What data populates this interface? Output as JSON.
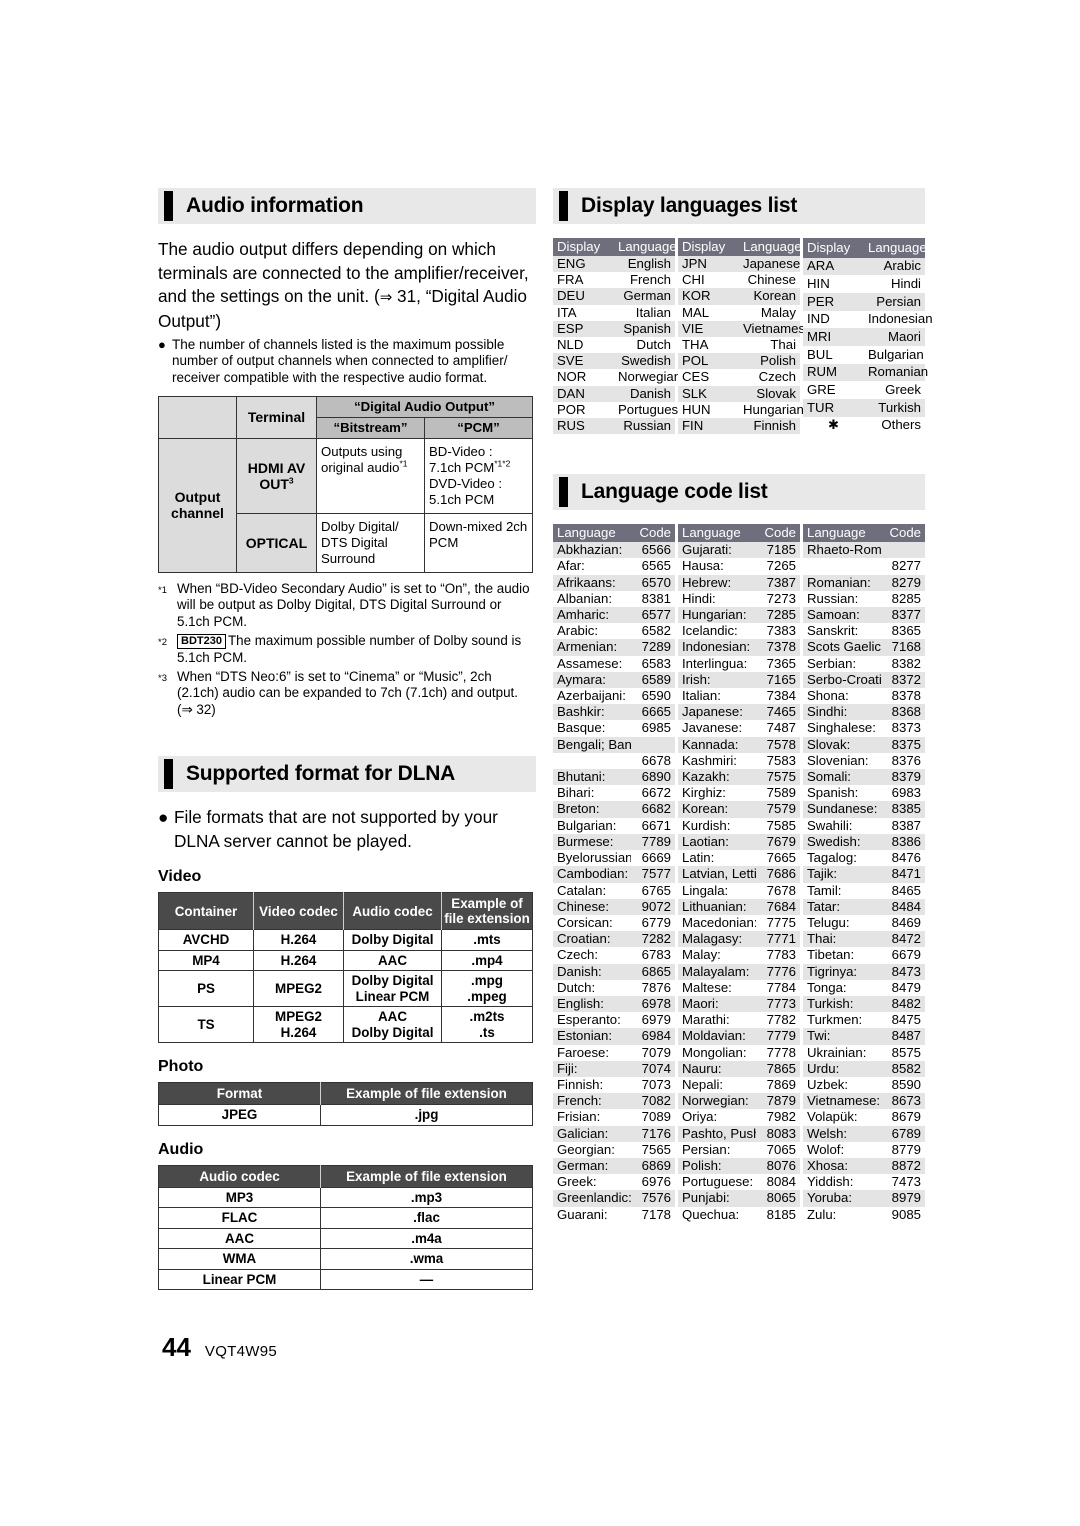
{
  "page": {
    "number": "44",
    "doc_code": "VQT4W95"
  },
  "audio_information": {
    "heading": "Audio information",
    "intro_line1": "The audio output differs depending on which",
    "intro_line2": "terminals are connected to the amplifier/receiver,",
    "intro_line3": "and the settings on the unit. (",
    "intro_arrow": "⇒",
    "intro_line3b": " 31, “Digital Audio",
    "intro_line4": "Output”)",
    "bullet": "The number of channels listed is the maximum possible number of output channels when connected to amplifier/ receiver compatible with the respective audio format.",
    "table": {
      "col_terminal": "Terminal",
      "col_group": "“Digital Audio Output”",
      "col_bitstream": "“Bitstream”",
      "col_pcm": "“PCM”",
      "row_label": "Output channel",
      "rows": [
        {
          "terminal": "HDMI AV OUT",
          "terminal_sup": "3",
          "bitstream": "Outputs using original audio",
          "bitstream_sup": "*1",
          "pcm_l1": "BD-Video :",
          "pcm_l2": "7.1ch PCM",
          "pcm_l2_sup": "*1*2",
          "pcm_l3": "DVD-Video :",
          "pcm_l4": "5.1ch PCM"
        },
        {
          "terminal": "OPTICAL",
          "terminal_sup": "",
          "bitstream": "Dolby Digital/ DTS Digital Surround",
          "bitstream_sup": "",
          "pcm_l1": "Down-mixed 2ch PCM",
          "pcm_l2": "",
          "pcm_l2_sup": "",
          "pcm_l3": "",
          "pcm_l4": ""
        }
      ]
    },
    "footnotes": [
      {
        "mark": "*1",
        "badge": "",
        "text": "When “BD-Video Secondary Audio” is set to “On”, the audio will be output as Dolby Digital, DTS Digital Surround or 5.1ch PCM."
      },
      {
        "mark": "*2",
        "badge": "BDT230",
        "text": "The maximum possible number of Dolby sound is 5.1ch PCM."
      },
      {
        "mark": "*3",
        "badge": "",
        "text": "When “DTS Neo:6” is set to “Cinema” or “Music”, 2ch (2.1ch) audio can be expanded to 7ch (7.1ch) and output. (⇒ 32)"
      }
    ]
  },
  "dlna": {
    "heading": "Supported format for DLNA",
    "bullet": "File formats that are not supported by your DLNA server cannot be played.",
    "video": {
      "subhead": "Video",
      "headers": [
        "Container",
        "Video codec",
        "Audio codec",
        "Example of file extension"
      ],
      "rows": [
        [
          "AVCHD",
          "H.264",
          "Dolby Digital",
          ".mts"
        ],
        [
          "MP4",
          "H.264",
          "AAC",
          ".mp4"
        ],
        [
          "PS",
          "MPEG2",
          "Dolby Digital\nLinear PCM",
          ".mpg\n.mpeg"
        ],
        [
          "TS",
          "MPEG2\nH.264",
          "AAC\nDolby Digital",
          ".m2ts\n.ts"
        ]
      ]
    },
    "photo": {
      "subhead": "Photo",
      "headers": [
        "Format",
        "Example of file extension"
      ],
      "rows": [
        [
          "JPEG",
          ".jpg"
        ]
      ]
    },
    "audio": {
      "subhead": "Audio",
      "headers": [
        "Audio codec",
        "Example of file extension"
      ],
      "rows": [
        [
          "MP3",
          ".mp3"
        ],
        [
          "FLAC",
          ".flac"
        ],
        [
          "AAC",
          ".m4a"
        ],
        [
          "WMA",
          ".wma"
        ],
        [
          "Linear PCM",
          "—"
        ]
      ]
    }
  },
  "display_languages": {
    "heading": "Display languages list",
    "col_display": "Display",
    "col_language": "Language",
    "columns": [
      [
        [
          "ENG",
          "English"
        ],
        [
          "FRA",
          "French"
        ],
        [
          "DEU",
          "German"
        ],
        [
          "ITA",
          "Italian"
        ],
        [
          "ESP",
          "Spanish"
        ],
        [
          "NLD",
          "Dutch"
        ],
        [
          "SVE",
          "Swedish"
        ],
        [
          "NOR",
          "Norwegian"
        ],
        [
          "DAN",
          "Danish"
        ],
        [
          "POR",
          "Portuguese"
        ],
        [
          "RUS",
          "Russian"
        ]
      ],
      [
        [
          "JPN",
          "Japanese"
        ],
        [
          "CHI",
          "Chinese"
        ],
        [
          "KOR",
          "Korean"
        ],
        [
          "MAL",
          "Malay"
        ],
        [
          "VIE",
          "Vietnamese"
        ],
        [
          "THA",
          "Thai"
        ],
        [
          "POL",
          "Polish"
        ],
        [
          "CES",
          "Czech"
        ],
        [
          "SLK",
          "Slovak"
        ],
        [
          "HUN",
          "Hungarian"
        ],
        [
          "FIN",
          "Finnish"
        ]
      ],
      [
        [
          "ARA",
          "Arabic"
        ],
        [
          "HIN",
          "Hindi"
        ],
        [
          "PER",
          "Persian"
        ],
        [
          "IND",
          "Indonesian"
        ],
        [
          "MRI",
          "Maori"
        ],
        [
          "BUL",
          "Bulgarian"
        ],
        [
          "RUM",
          "Romanian"
        ],
        [
          "GRE",
          "Greek"
        ],
        [
          "TUR",
          "Turkish"
        ],
        [
          "✱",
          "Others"
        ]
      ]
    ]
  },
  "language_codes": {
    "heading": "Language code list",
    "col_language": "Language",
    "col_code": "Code",
    "columns": [
      [
        [
          "Abkhazian:",
          "6566"
        ],
        [
          "Afar:",
          "6565"
        ],
        [
          "Afrikaans:",
          "6570"
        ],
        [
          "Albanian:",
          "8381"
        ],
        [
          "Amharic:",
          "6577"
        ],
        [
          "Arabic:",
          "6582"
        ],
        [
          "Armenian:",
          "7289"
        ],
        [
          "Assamese:",
          "6583"
        ],
        [
          "Aymara:",
          "6589"
        ],
        [
          "Azerbaijani:",
          "6590"
        ],
        [
          "Bashkir:",
          "6665"
        ],
        [
          "Basque:",
          "6985"
        ],
        [
          "Bengali; Bangla:",
          ""
        ],
        [
          "",
          "6678"
        ],
        [
          "Bhutani:",
          "6890"
        ],
        [
          "Bihari:",
          "6672"
        ],
        [
          "Breton:",
          "6682"
        ],
        [
          "Bulgarian:",
          "6671"
        ],
        [
          "Burmese:",
          "7789"
        ],
        [
          "Byelorussian:",
          "6669"
        ],
        [
          "Cambodian:",
          "7577"
        ],
        [
          "Catalan:",
          "6765"
        ],
        [
          "Chinese:",
          "9072"
        ],
        [
          "Corsican:",
          "6779"
        ],
        [
          "Croatian:",
          "7282"
        ],
        [
          "Czech:",
          "6783"
        ],
        [
          "Danish:",
          "6865"
        ],
        [
          "Dutch:",
          "7876"
        ],
        [
          "English:",
          "6978"
        ],
        [
          "Esperanto:",
          "6979"
        ],
        [
          "Estonian:",
          "6984"
        ],
        [
          "Faroese:",
          "7079"
        ],
        [
          "Fiji:",
          "7074"
        ],
        [
          "Finnish:",
          "7073"
        ],
        [
          "French:",
          "7082"
        ],
        [
          "Frisian:",
          "7089"
        ],
        [
          "Galician:",
          "7176"
        ],
        [
          "Georgian:",
          "7565"
        ],
        [
          "German:",
          "6869"
        ],
        [
          "Greek:",
          "6976"
        ],
        [
          "Greenlandic:",
          "7576"
        ],
        [
          "Guarani:",
          "7178"
        ]
      ],
      [
        [
          "Gujarati:",
          "7185"
        ],
        [
          "Hausa:",
          "7265"
        ],
        [
          "Hebrew:",
          "7387"
        ],
        [
          "Hindi:",
          "7273"
        ],
        [
          "Hungarian:",
          "7285"
        ],
        [
          "Icelandic:",
          "7383"
        ],
        [
          "Indonesian:",
          "7378"
        ],
        [
          "Interlingua:",
          "7365"
        ],
        [
          "Irish:",
          "7165"
        ],
        [
          "Italian:",
          "7384"
        ],
        [
          "Japanese:",
          "7465"
        ],
        [
          "Javanese:",
          "7487"
        ],
        [
          "Kannada:",
          "7578"
        ],
        [
          "Kashmiri:",
          "7583"
        ],
        [
          "Kazakh:",
          "7575"
        ],
        [
          "Kirghiz:",
          "7589"
        ],
        [
          "Korean:",
          "7579"
        ],
        [
          "Kurdish:",
          "7585"
        ],
        [
          "Laotian:",
          "7679"
        ],
        [
          "Latin:",
          "7665"
        ],
        [
          "Latvian, Lettish:",
          "7686"
        ],
        [
          "Lingala:",
          "7678"
        ],
        [
          "Lithuanian:",
          "7684"
        ],
        [
          "Macedonian:",
          "7775"
        ],
        [
          "Malagasy:",
          "7771"
        ],
        [
          "Malay:",
          "7783"
        ],
        [
          "Malayalam:",
          "7776"
        ],
        [
          "Maltese:",
          "7784"
        ],
        [
          "Maori:",
          "7773"
        ],
        [
          "Marathi:",
          "7782"
        ],
        [
          "Moldavian:",
          "7779"
        ],
        [
          "Mongolian:",
          "7778"
        ],
        [
          "Nauru:",
          "7865"
        ],
        [
          "Nepali:",
          "7869"
        ],
        [
          "Norwegian:",
          "7879"
        ],
        [
          "Oriya:",
          "7982"
        ],
        [
          "Pashto, Pushto:",
          "8083"
        ],
        [
          "Persian:",
          "7065"
        ],
        [
          "Polish:",
          "8076"
        ],
        [
          "Portuguese:",
          "8084"
        ],
        [
          "Punjabi:",
          "8065"
        ],
        [
          "Quechua:",
          "8185"
        ]
      ],
      [
        [
          "Rhaeto-Romance:",
          ""
        ],
        [
          "",
          "8277"
        ],
        [
          "Romanian:",
          "8279"
        ],
        [
          "Russian:",
          "8285"
        ],
        [
          "Samoan:",
          "8377"
        ],
        [
          "Sanskrit:",
          "8365"
        ],
        [
          "Scots Gaelic:",
          "7168"
        ],
        [
          "Serbian:",
          "8382"
        ],
        [
          "Serbo-Croatian:",
          "8372"
        ],
        [
          "Shona:",
          "8378"
        ],
        [
          "Sindhi:",
          "8368"
        ],
        [
          "Singhalese:",
          "8373"
        ],
        [
          "Slovak:",
          "8375"
        ],
        [
          "Slovenian:",
          "8376"
        ],
        [
          "Somali:",
          "8379"
        ],
        [
          "Spanish:",
          "6983"
        ],
        [
          "Sundanese:",
          "8385"
        ],
        [
          "Swahili:",
          "8387"
        ],
        [
          "Swedish:",
          "8386"
        ],
        [
          "Tagalog:",
          "8476"
        ],
        [
          "Tajik:",
          "8471"
        ],
        [
          "Tamil:",
          "8465"
        ],
        [
          "Tatar:",
          "8484"
        ],
        [
          "Telugu:",
          "8469"
        ],
        [
          "Thai:",
          "8472"
        ],
        [
          "Tibetan:",
          "6679"
        ],
        [
          "Tigrinya:",
          "8473"
        ],
        [
          "Tonga:",
          "8479"
        ],
        [
          "Turkish:",
          "8482"
        ],
        [
          "Turkmen:",
          "8475"
        ],
        [
          "Twi:",
          "8487"
        ],
        [
          "Ukrainian:",
          "8575"
        ],
        [
          "Urdu:",
          "8582"
        ],
        [
          "Uzbek:",
          "8590"
        ],
        [
          "Vietnamese:",
          "8673"
        ],
        [
          "Volapük:",
          "8679"
        ],
        [
          "Welsh:",
          "6789"
        ],
        [
          "Wolof:",
          "8779"
        ],
        [
          "Xhosa:",
          "8872"
        ],
        [
          "Yiddish:",
          "7473"
        ],
        [
          "Yoruba:",
          "8979"
        ],
        [
          "Zulu:",
          "9085"
        ]
      ]
    ]
  }
}
